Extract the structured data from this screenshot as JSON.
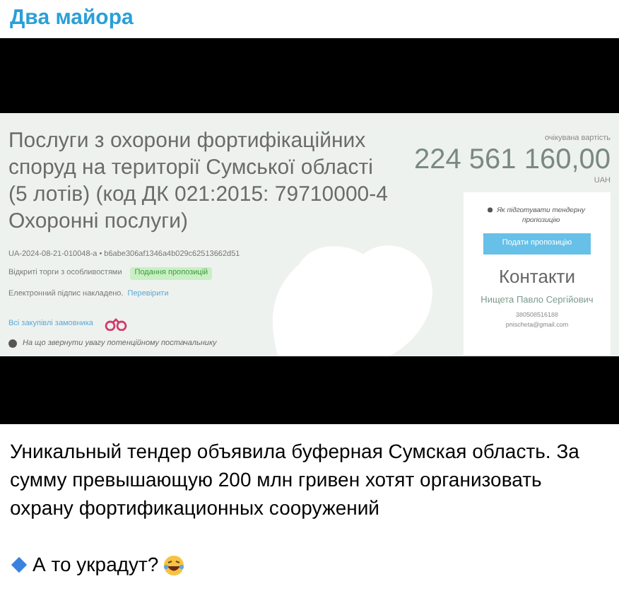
{
  "channel": {
    "name": "Два майора"
  },
  "screenshot": {
    "title": "Послуги з охорони фортифікаційних споруд на території Сумської області (5 лотів) (код ДК 021:2015: 79710000-4 Охоронні послуги)",
    "tender_id": "UA-2024-08-21-010048-a • b6abe306af1346a4b029c62513662d51",
    "procedure": "Відкриті торги з особливостями",
    "status_badge": "Подання пропозицій",
    "signature": "Електронний підпис накладено.",
    "verify_link": "Перевірити",
    "all_purchases_link": "Всі закупівлі замовника",
    "hint": "На що звернути увагу потенційному постачальнику",
    "value_label": "очікувана вартість",
    "value": "224 561 160,00",
    "currency": "UAH",
    "card": {
      "help_link": "Як підготувати тендерну пропозицію",
      "button": "Подати пропозицію",
      "contacts_title": "Контакти",
      "contact_name": "Нищета Павло Сергійович",
      "phone": "380508516188",
      "email": "pnischeta@gmail.com"
    }
  },
  "post": {
    "text": "Уникальный тендер объявила буферная Сумская область. За сумму превышающую 200 млн гривен хотят организовать охрану фортификационных сооружений",
    "footer": "А то украдут?"
  }
}
